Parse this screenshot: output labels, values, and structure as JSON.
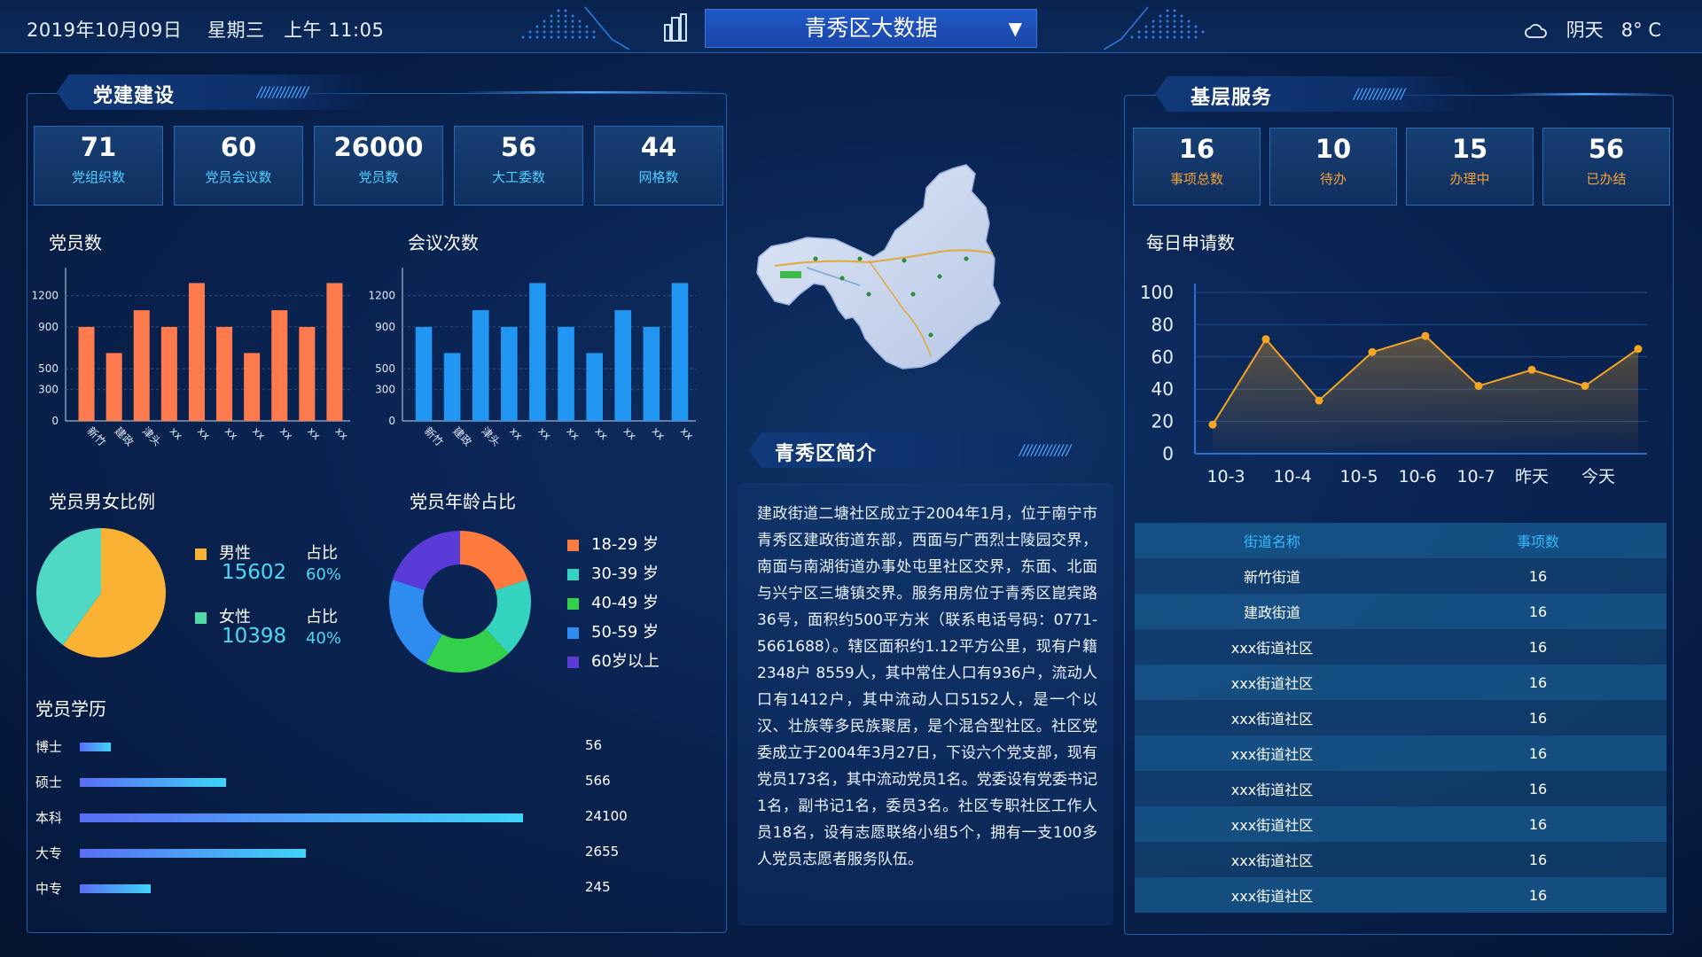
{
  "header": {
    "date": "2019年10月09日",
    "weekday": "星期三",
    "time": "上午 11:05",
    "title": "青秀区大数据",
    "weather_text": "阴天",
    "temperature": "8° C"
  },
  "party": {
    "title": "党建建设",
    "stats": [
      {
        "value": "71",
        "label": "党组织数"
      },
      {
        "value": "60",
        "label": "党员会议数"
      },
      {
        "value": "26000",
        "label": "党员数"
      },
      {
        "value": "56",
        "label": "大工委数"
      },
      {
        "value": "44",
        "label": "网格数"
      }
    ],
    "members_chart_title": "党员数",
    "meetings_chart_title": "会议次数",
    "gender_title": "党员男女比例",
    "age_title": "党员年龄占比",
    "education_title": "党员学历",
    "gender": {
      "male_label": "男性",
      "male_value": "15602",
      "male_ratio_label": "占比",
      "male_ratio": "60%",
      "female_label": "女性",
      "female_value": "10398",
      "female_ratio_label": "占比",
      "female_ratio": "40%"
    },
    "education": [
      {
        "label": "博士",
        "value": "56",
        "fraction": 0.07
      },
      {
        "label": "硕士",
        "value": "566",
        "fraction": 0.33
      },
      {
        "label": "本科",
        "value": "24100",
        "fraction": 1.0
      },
      {
        "label": "大专",
        "value": "2655",
        "fraction": 0.51
      },
      {
        "label": "中专",
        "value": "245",
        "fraction": 0.16
      }
    ]
  },
  "intro": {
    "title": "青秀区简介",
    "text": "建政街道二塘社区成立于2004年1月，位于南宁市青秀区建政街道东部，西面与广西烈士陵园交界，南面与南湖街道办事处屯里社区交界，东面、北面与兴宁区三塘镇交界。服务用房位于青秀区崑宾路36号，面积约500平方米（联系电话号码：0771-5661688）。辖区面积约1.12平方公里，现有户籍2348户 8559人，其中常住人口有936户，流动人口有1412户，其中流动人口5152人，是一个以汉、壮族等多民族聚居，是个混合型社区。社区党委成立于2004年3月27日，下设六个党支部，现有党员173名，其中流动党员1名。党委设有党委书记1名，副书记1名，委员3名。社区专职社区工作人员18名，设有志愿联络小组5个，拥有一支100多人党员志愿者服务队伍。"
  },
  "service": {
    "title": "基层服务",
    "stats": [
      {
        "value": "16",
        "label": "事项总数"
      },
      {
        "value": "10",
        "label": "待办"
      },
      {
        "value": "15",
        "label": "办理中"
      },
      {
        "value": "56",
        "label": "已办结"
      }
    ],
    "daily_title": "每日申请数",
    "table_headers": [
      "街道名称",
      "事项数"
    ],
    "table_rows": [
      [
        "新竹街道",
        "16"
      ],
      [
        "建政街道",
        "16"
      ],
      [
        "xxx街道社区",
        "16"
      ],
      [
        "xxx街道社区",
        "16"
      ],
      [
        "xxx街道社区",
        "16"
      ],
      [
        "xxx街道社区",
        "16"
      ],
      [
        "xxx街道社区",
        "16"
      ],
      [
        "xxx街道社区",
        "16"
      ],
      [
        "xxx街道社区",
        "16"
      ],
      [
        "xxx街道社区",
        "16"
      ]
    ]
  },
  "colors": {
    "bar_orange": "#ff7a4d",
    "bar_blue": "#2196f3",
    "male": "#f9b233",
    "female": "#4fd8c4",
    "line": "#f5a623",
    "accent": "#35b9ff"
  },
  "chart_data": [
    {
      "type": "bar",
      "title": "党员数",
      "categories": [
        "新竹",
        "建政",
        "津头",
        "xx",
        "xx",
        "xx",
        "xx",
        "xx",
        "xx",
        "xx"
      ],
      "values": [
        900,
        650,
        1060,
        900,
        1320,
        900,
        650,
        1060,
        900,
        1320
      ],
      "yticks": [
        0,
        300,
        500,
        900,
        1200
      ],
      "ylim": [
        0,
        1400
      ],
      "color": "#ff7a4d"
    },
    {
      "type": "bar",
      "title": "会议次数",
      "categories": [
        "新竹",
        "建政",
        "津头",
        "xx",
        "xx",
        "xx",
        "xx",
        "xx",
        "xx",
        "xx"
      ],
      "values": [
        900,
        650,
        1060,
        900,
        1320,
        900,
        650,
        1060,
        900,
        1320
      ],
      "yticks": [
        0,
        300,
        500,
        900,
        1200
      ],
      "ylim": [
        0,
        1400
      ],
      "color": "#2196f3"
    },
    {
      "type": "pie",
      "title": "党员男女比例",
      "labels": [
        "男性",
        "女性"
      ],
      "values": [
        15602,
        10398
      ]
    },
    {
      "type": "pie",
      "title": "党员年龄占比",
      "donut": true,
      "labels": [
        "18-29 岁",
        "30-39 岁",
        "40-49 岁",
        "50-59 岁",
        "60岁以上"
      ],
      "values": [
        20,
        18,
        20,
        22,
        20
      ],
      "colors": [
        "#ff7a3d",
        "#34d4c0",
        "#33d14a",
        "#2e8cf0",
        "#5a3bd8"
      ]
    },
    {
      "type": "area",
      "title": "每日申请数",
      "categories": [
        "10-3",
        "10-4",
        "10-5",
        "10-6",
        "10-7",
        "昨天",
        "今天"
      ],
      "x_points": [
        0,
        1,
        2,
        3,
        4,
        5,
        6,
        7,
        8
      ],
      "x_tick_positions": [
        0.25,
        1.5,
        2.75,
        3.85,
        4.95,
        6.0,
        7.25
      ],
      "values": [
        18,
        71,
        33,
        63,
        73,
        42,
        52,
        42,
        65
      ],
      "yticks": [
        0,
        20,
        40,
        60,
        80,
        100
      ],
      "ylim": [
        0,
        100
      ]
    }
  ]
}
